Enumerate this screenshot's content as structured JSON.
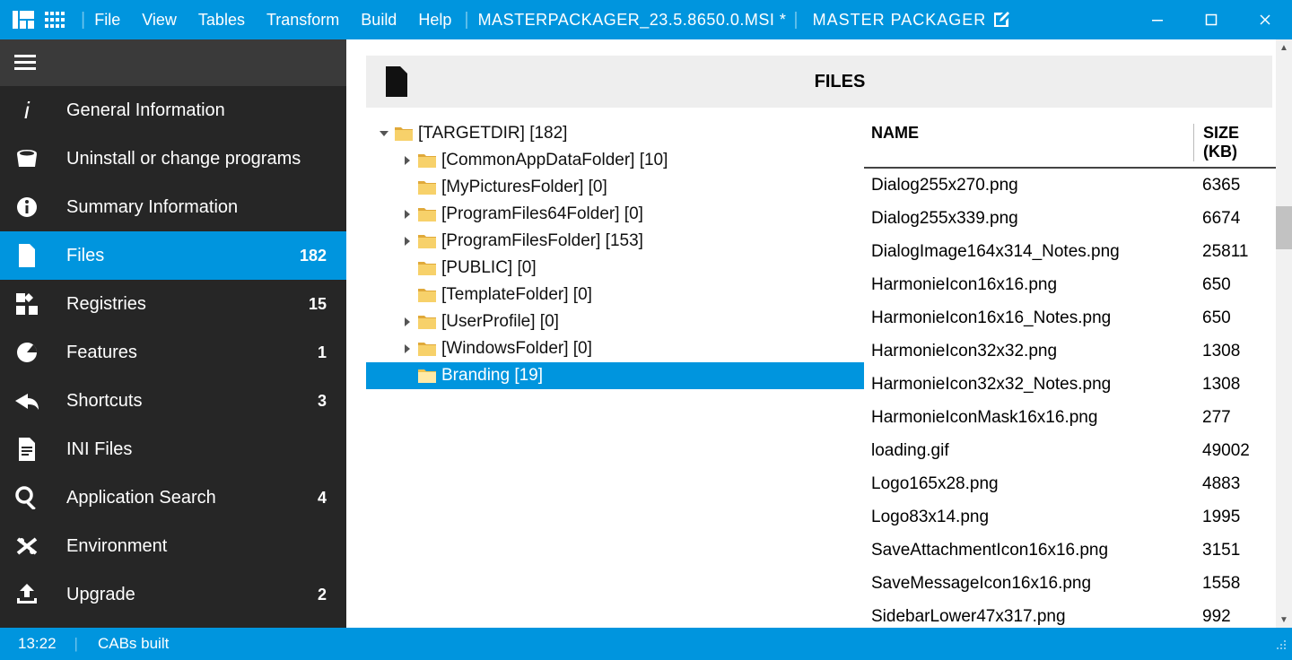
{
  "title": {
    "menu": [
      "File",
      "View",
      "Tables",
      "Transform",
      "Build",
      "Help"
    ],
    "document": "MASTERPACKAGER_23.5.8650.0.MSI *",
    "brand": "MASTER PACKAGER"
  },
  "sidebar": {
    "items": [
      {
        "icon": "info-i",
        "label": "General Information",
        "count": ""
      },
      {
        "icon": "uninstall",
        "label": "Uninstall or change programs",
        "count": ""
      },
      {
        "icon": "info-circle",
        "label": "Summary Information",
        "count": ""
      },
      {
        "icon": "file",
        "label": "Files",
        "count": "182",
        "selected": true
      },
      {
        "icon": "registry",
        "label": "Registries",
        "count": "15"
      },
      {
        "icon": "pie",
        "label": "Features",
        "count": "1"
      },
      {
        "icon": "shortcut",
        "label": "Shortcuts",
        "count": "3"
      },
      {
        "icon": "ini",
        "label": "INI Files",
        "count": ""
      },
      {
        "icon": "search",
        "label": "Application Search",
        "count": "4"
      },
      {
        "icon": "env",
        "label": "Environment",
        "count": ""
      },
      {
        "icon": "upgrade",
        "label": "Upgrade",
        "count": "2"
      }
    ]
  },
  "header": {
    "title": "FILES"
  },
  "tree": [
    {
      "indent": 0,
      "expander": "open",
      "label": "[TARGETDIR] [182]"
    },
    {
      "indent": 1,
      "expander": "closed",
      "label": "[CommonAppDataFolder] [10]"
    },
    {
      "indent": 1,
      "expander": "none",
      "label": "[MyPicturesFolder] [0]"
    },
    {
      "indent": 1,
      "expander": "closed",
      "label": "[ProgramFiles64Folder] [0]"
    },
    {
      "indent": 1,
      "expander": "closed",
      "label": "[ProgramFilesFolder] [153]"
    },
    {
      "indent": 1,
      "expander": "none",
      "label": "[PUBLIC] [0]"
    },
    {
      "indent": 1,
      "expander": "none",
      "label": "[TemplateFolder] [0]"
    },
    {
      "indent": 1,
      "expander": "closed",
      "label": "[UserProfile] [0]"
    },
    {
      "indent": 1,
      "expander": "closed",
      "label": "[WindowsFolder] [0]"
    },
    {
      "indent": 1,
      "expander": "none",
      "label": "Branding [19]",
      "selected": true
    }
  ],
  "table": {
    "columns": {
      "name": "NAME",
      "size": "SIZE (KB)"
    },
    "rows": [
      {
        "name": "Dialog255x270.png",
        "size": "6365"
      },
      {
        "name": "Dialog255x339.png",
        "size": "6674"
      },
      {
        "name": "DialogImage164x314_Notes.png",
        "size": "25811"
      },
      {
        "name": "HarmonieIcon16x16.png",
        "size": "650"
      },
      {
        "name": "HarmonieIcon16x16_Notes.png",
        "size": "650"
      },
      {
        "name": "HarmonieIcon32x32.png",
        "size": "1308"
      },
      {
        "name": "HarmonieIcon32x32_Notes.png",
        "size": "1308"
      },
      {
        "name": "HarmonieIconMask16x16.png",
        "size": "277"
      },
      {
        "name": "loading.gif",
        "size": "49002"
      },
      {
        "name": "Logo165x28.png",
        "size": "4883"
      },
      {
        "name": "Logo83x14.png",
        "size": "1995"
      },
      {
        "name": "SaveAttachmentIcon16x16.png",
        "size": "3151"
      },
      {
        "name": "SaveMessageIcon16x16.png",
        "size": "1558"
      },
      {
        "name": "SidebarLower47x317.png",
        "size": "992"
      }
    ]
  },
  "status": {
    "time": "13:22",
    "message": "CABs built"
  }
}
